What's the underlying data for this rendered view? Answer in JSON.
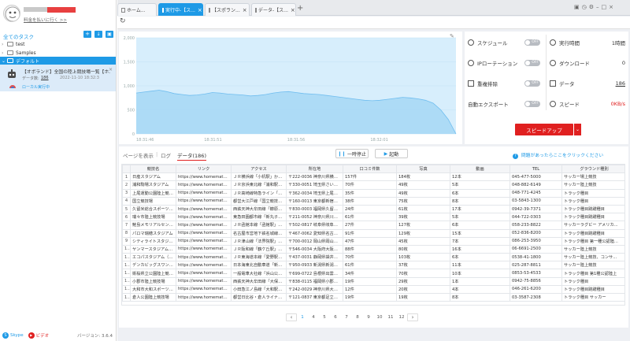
{
  "account": {
    "name": "",
    "note": "料金を払いに行く >>"
  },
  "sidebar": {
    "all_tasks": "全てのタスク",
    "folders": [
      {
        "label": "test"
      },
      {
        "label": "Samples"
      }
    ],
    "default_group": "デフォルト",
    "task": {
      "title": "【オボランド】全国の陸上競技場一覧【ホ...",
      "data_label": "データ数:",
      "data_count": "186",
      "date": "2022-11-10 18:32:3",
      "status": "ローカル実行中"
    },
    "footer": {
      "skype": "Skype",
      "video": "ビデオ",
      "version": "バージョン: 3.6.4"
    }
  },
  "tabs": [
    {
      "label": "ホーム..."
    },
    {
      "label": "実行中-【ス..."
    },
    {
      "label": "【スポラン..."
    },
    {
      "label": "データ-【ス..."
    }
  ],
  "chart_data": {
    "type": "area",
    "ylim": [
      0,
      2000
    ],
    "yticks": [
      "2,000",
      "1,500",
      "1,000",
      "500",
      "0"
    ],
    "x": [
      "18:31:46",
      "18:31:51",
      "18:31:56",
      "18:32:01"
    ],
    "series": [
      {
        "values": [
          850,
          870,
          890,
          910,
          880,
          840,
          820,
          800,
          810,
          830,
          860,
          850,
          830,
          820,
          810,
          790,
          800,
          820,
          850,
          870,
          880,
          860,
          840,
          830,
          820,
          800,
          780,
          760,
          740,
          720,
          700,
          690,
          700,
          720,
          740,
          760,
          750,
          730,
          700,
          640,
          500,
          300,
          0
        ]
      }
    ]
  },
  "settings": {
    "schedule": {
      "label": "スケジュール",
      "state": "OFF"
    },
    "ip_rotation": {
      "label": "IPローテーション",
      "state": "OFF"
    },
    "dedupe": {
      "label": "重複排除",
      "state": "OFF"
    },
    "auto_export": {
      "label": "自動エクスポート",
      "state": "OFF"
    },
    "run_time": {
      "label": "実行時間",
      "value": "1時間"
    },
    "download": {
      "label": "ダウンロード",
      "value": "0"
    },
    "data": {
      "label": "データ",
      "value": "186"
    },
    "speed": {
      "label": "スピード",
      "value": "0KB/s"
    },
    "speed_up_button": "スピードアップ"
  },
  "data_panel": {
    "page_view": "ページを表示",
    "separator": "|",
    "log": "ログ",
    "data_tab": "データ(186)",
    "pause_button": "一時停止",
    "start_button": "起動",
    "help": "問題があったらここをクリックください"
  },
  "table": {
    "columns": [
      "",
      "競技名",
      "リンク",
      "アクセス",
      "所在地",
      "口コミ件数",
      "写真",
      "動画",
      "TEL",
      "グラウンド種別"
    ],
    "rows": [
      [
        "1",
        "日産スタジアム",
        "https://www.homemate-rese...",
        "ＪＲ横浜線「小机駅」から...",
        "〒222-0036 神奈川県横浜市...",
        "157件",
        "184枚",
        "12本",
        "045-477-5000",
        "サッカー場上競技"
      ],
      [
        "2",
        "浦和駒場スタジアム",
        "https://www.homemate-rese...",
        "ＪＲ京浜東北線「浦和駅」...",
        "〒330-0051 埼玉県さいたま...",
        "70件",
        "49枚",
        "5本",
        "048-882-6149",
        "サッカー陸上競技"
      ],
      [
        "3",
        "上尾運動公園陸上競技場",
        "https://www.homemate-rese...",
        "ＪＲ高崎線特急ライン「上尾...",
        "〒362-0034 埼玉県上尾市愛...",
        "35件",
        "49枚",
        "6本",
        "048-771-4245",
        "トラック種目"
      ],
      [
        "4",
        "国立競技場",
        "https://www.homemate-rese...",
        "都営大江戸線「国立競技場...",
        "〒160-0013 東京都新宿区霞...",
        "38件",
        "75枚",
        "8本",
        "03-5843-1300",
        "トラック種目"
      ],
      [
        "5",
        "久留米総合スポーツセンタ...",
        "https://www.homemate-rese...",
        "西鉄天神大牟田線「櫛原駅...",
        "〒830-0003 福岡県久留米市...",
        "24件",
        "61枚",
        "17本",
        "0942-39-7371",
        "トラック種目跳躍種目"
      ],
      [
        "6",
        "瑞々市陸上競技場",
        "https://www.homemate-rese...",
        "東急田園都市線「新丸子駅」...",
        "〒211-0052 神奈川県川崎市...",
        "61件",
        "39枚",
        "5本",
        "044-722-0303",
        "トラック種目跳躍種目"
      ],
      [
        "7",
        "鮭島メモリアルセンター具...",
        "https://www.homemate-rese...",
        "ＪＲ函館本線「函館駅」から...",
        "〒502-0817 岐阜県岐阜市長...",
        "27件",
        "127枚",
        "6本",
        "058-233-8822",
        "サッカーラグビー アメリカ..."
      ],
      [
        "8",
        "パロマ瑞穂スタジアム",
        "https://www.homemate-rese...",
        "名古屋市営地下鉄名城線「...",
        "〒467-0062 愛知県名古屋市...",
        "91件",
        "129枚",
        "15本",
        "052-836-8200",
        "トラック種目跳躍種目"
      ],
      [
        "9",
        "シティライトスタジアム",
        "https://www.homemate-rese...",
        "ＪＲ津山線「法界院駅」か...",
        "〒700-0012 岡山県岡山市北...",
        "47件",
        "45枚",
        "7本",
        "086-253-3950",
        "トラック種目 第一種公認陸..."
      ],
      [
        "10",
        "ヤンマースタジアム長居",
        "https://www.homemate-rese...",
        "ＪＲ阪和線「鶴ケ丘駅」か...",
        "〒546-0034 大阪府大阪市東...",
        "88件",
        "80枚",
        "16本",
        "06-6691-2500",
        "サッカー陸上競技"
      ],
      [
        "11",
        "エコパスタジアム（静岡ス...",
        "https://www.homemate-rese...",
        "ＪＲ東海道本線「愛野駅」...",
        "〒437-0031 静岡県袋井市愛...",
        "70件",
        "103枚",
        "6本",
        "0538-41-1800",
        "サッカー陸上競技、コンサ..."
      ],
      [
        "12",
        "デンカビッグスワンスタジ...",
        "https://www.homemate-rese...",
        "日本海東北自動車道「新潟...",
        "〒950-0933 新潟県新潟市中...",
        "61件",
        "37枚",
        "11本",
        "025-287-8811",
        "サッカー陸上競技"
      ],
      [
        "13",
        "衛桜県立公園陸上競技場",
        "https://www.homemate-rese...",
        "一般電車大社線「浜山公園...",
        "〒699-0722 島根県出雲市大...",
        "34件",
        "70枚",
        "10本",
        "0853-53-4533",
        "トラック種目 第1種公認陸上"
      ],
      [
        "14",
        "小郡市陸上競技場",
        "https://www.homemate-rese...",
        "西鉄天神大牟田線「大保駅」...",
        "〒838-0115 福岡県小郡市大...",
        "19件",
        "29枚",
        "1本",
        "0942-75-8856",
        "トラック種目"
      ],
      [
        "15",
        "大和市大和スポーツセンタ...",
        "https://www.homemate-rese...",
        "小田急江ノ島線「大和駅」...",
        "〒242-0029 神奈川県大和市...",
        "12件",
        "20枚",
        "4本",
        "046-261-6200",
        "トラック種目跳躍種目"
      ],
      [
        "16",
        "倉人公園陸上競技場",
        "https://www.homemate-rese...",
        "都営日比谷・倉人ライナー...",
        "〒121-0837 東京都足立区舎...",
        "19件",
        "19枚",
        "8本",
        "03-3587-2308",
        "トラック種目 サッカー"
      ]
    ]
  },
  "pagination": {
    "prev": "‹",
    "next": "›",
    "pages": [
      "1",
      "4",
      "5",
      "6",
      "7",
      "8",
      "9",
      "10",
      "11",
      "12"
    ]
  },
  "colors": {
    "accent": "#1e9ae6",
    "danger": "#e02020",
    "chart_fill": "#a9d8f5",
    "chart_bg": "#d7eefc"
  }
}
